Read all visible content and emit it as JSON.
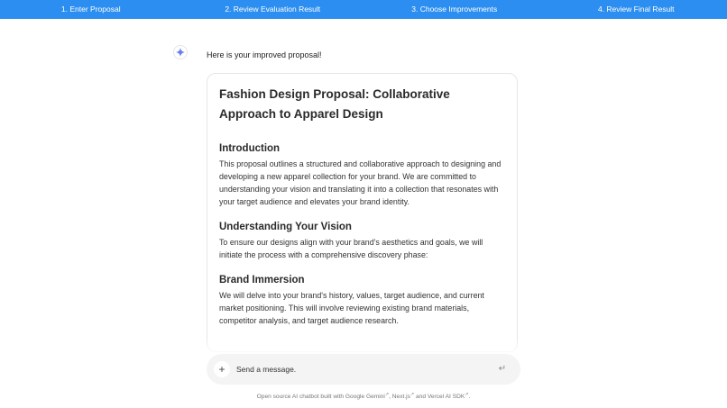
{
  "stepper": {
    "steps": [
      {
        "label": "1. Enter Proposal"
      },
      {
        "label": "2. Review Evaluation Result"
      },
      {
        "label": "3. Choose Improvements"
      },
      {
        "label": "4. Review Final Result"
      }
    ]
  },
  "chat": {
    "assistant_icon": "sparkle-icon",
    "intro": "Here is your improved proposal!"
  },
  "proposal": {
    "title": "Fashion Design Proposal: Collaborative Approach to Apparel Design",
    "sections": [
      {
        "heading": "Introduction",
        "body": "This proposal outlines a structured and collaborative approach to designing and developing a new apparel collection for your brand. We are committed to understanding your vision and translating it into a collection that resonates with your target audience and elevates your brand identity."
      },
      {
        "heading": "Understanding Your Vision",
        "body": "To ensure our designs align with your brand's aesthetics and goals, we will initiate the process with a comprehensive discovery phase:"
      },
      {
        "heading": "Brand Immersion",
        "body": "We will delve into your brand's history, values, target audience, and current market positioning. This will involve reviewing existing brand materials, competitor analysis, and target audience research."
      }
    ]
  },
  "composer": {
    "plus_icon": "plus-icon",
    "placeholder": "Send a message.",
    "send_icon": "return-icon"
  },
  "footer": {
    "prefix": "Open source AI chatbot built with",
    "link1": "Google Gemini",
    "sep1": ",",
    "link2": "Next.js",
    "sep2": "and",
    "link3": "Vercel AI SDK",
    "suffix": "."
  },
  "colors": {
    "stepper_bg": "#2b8ef0",
    "sparkle": "#6a7cf0"
  }
}
